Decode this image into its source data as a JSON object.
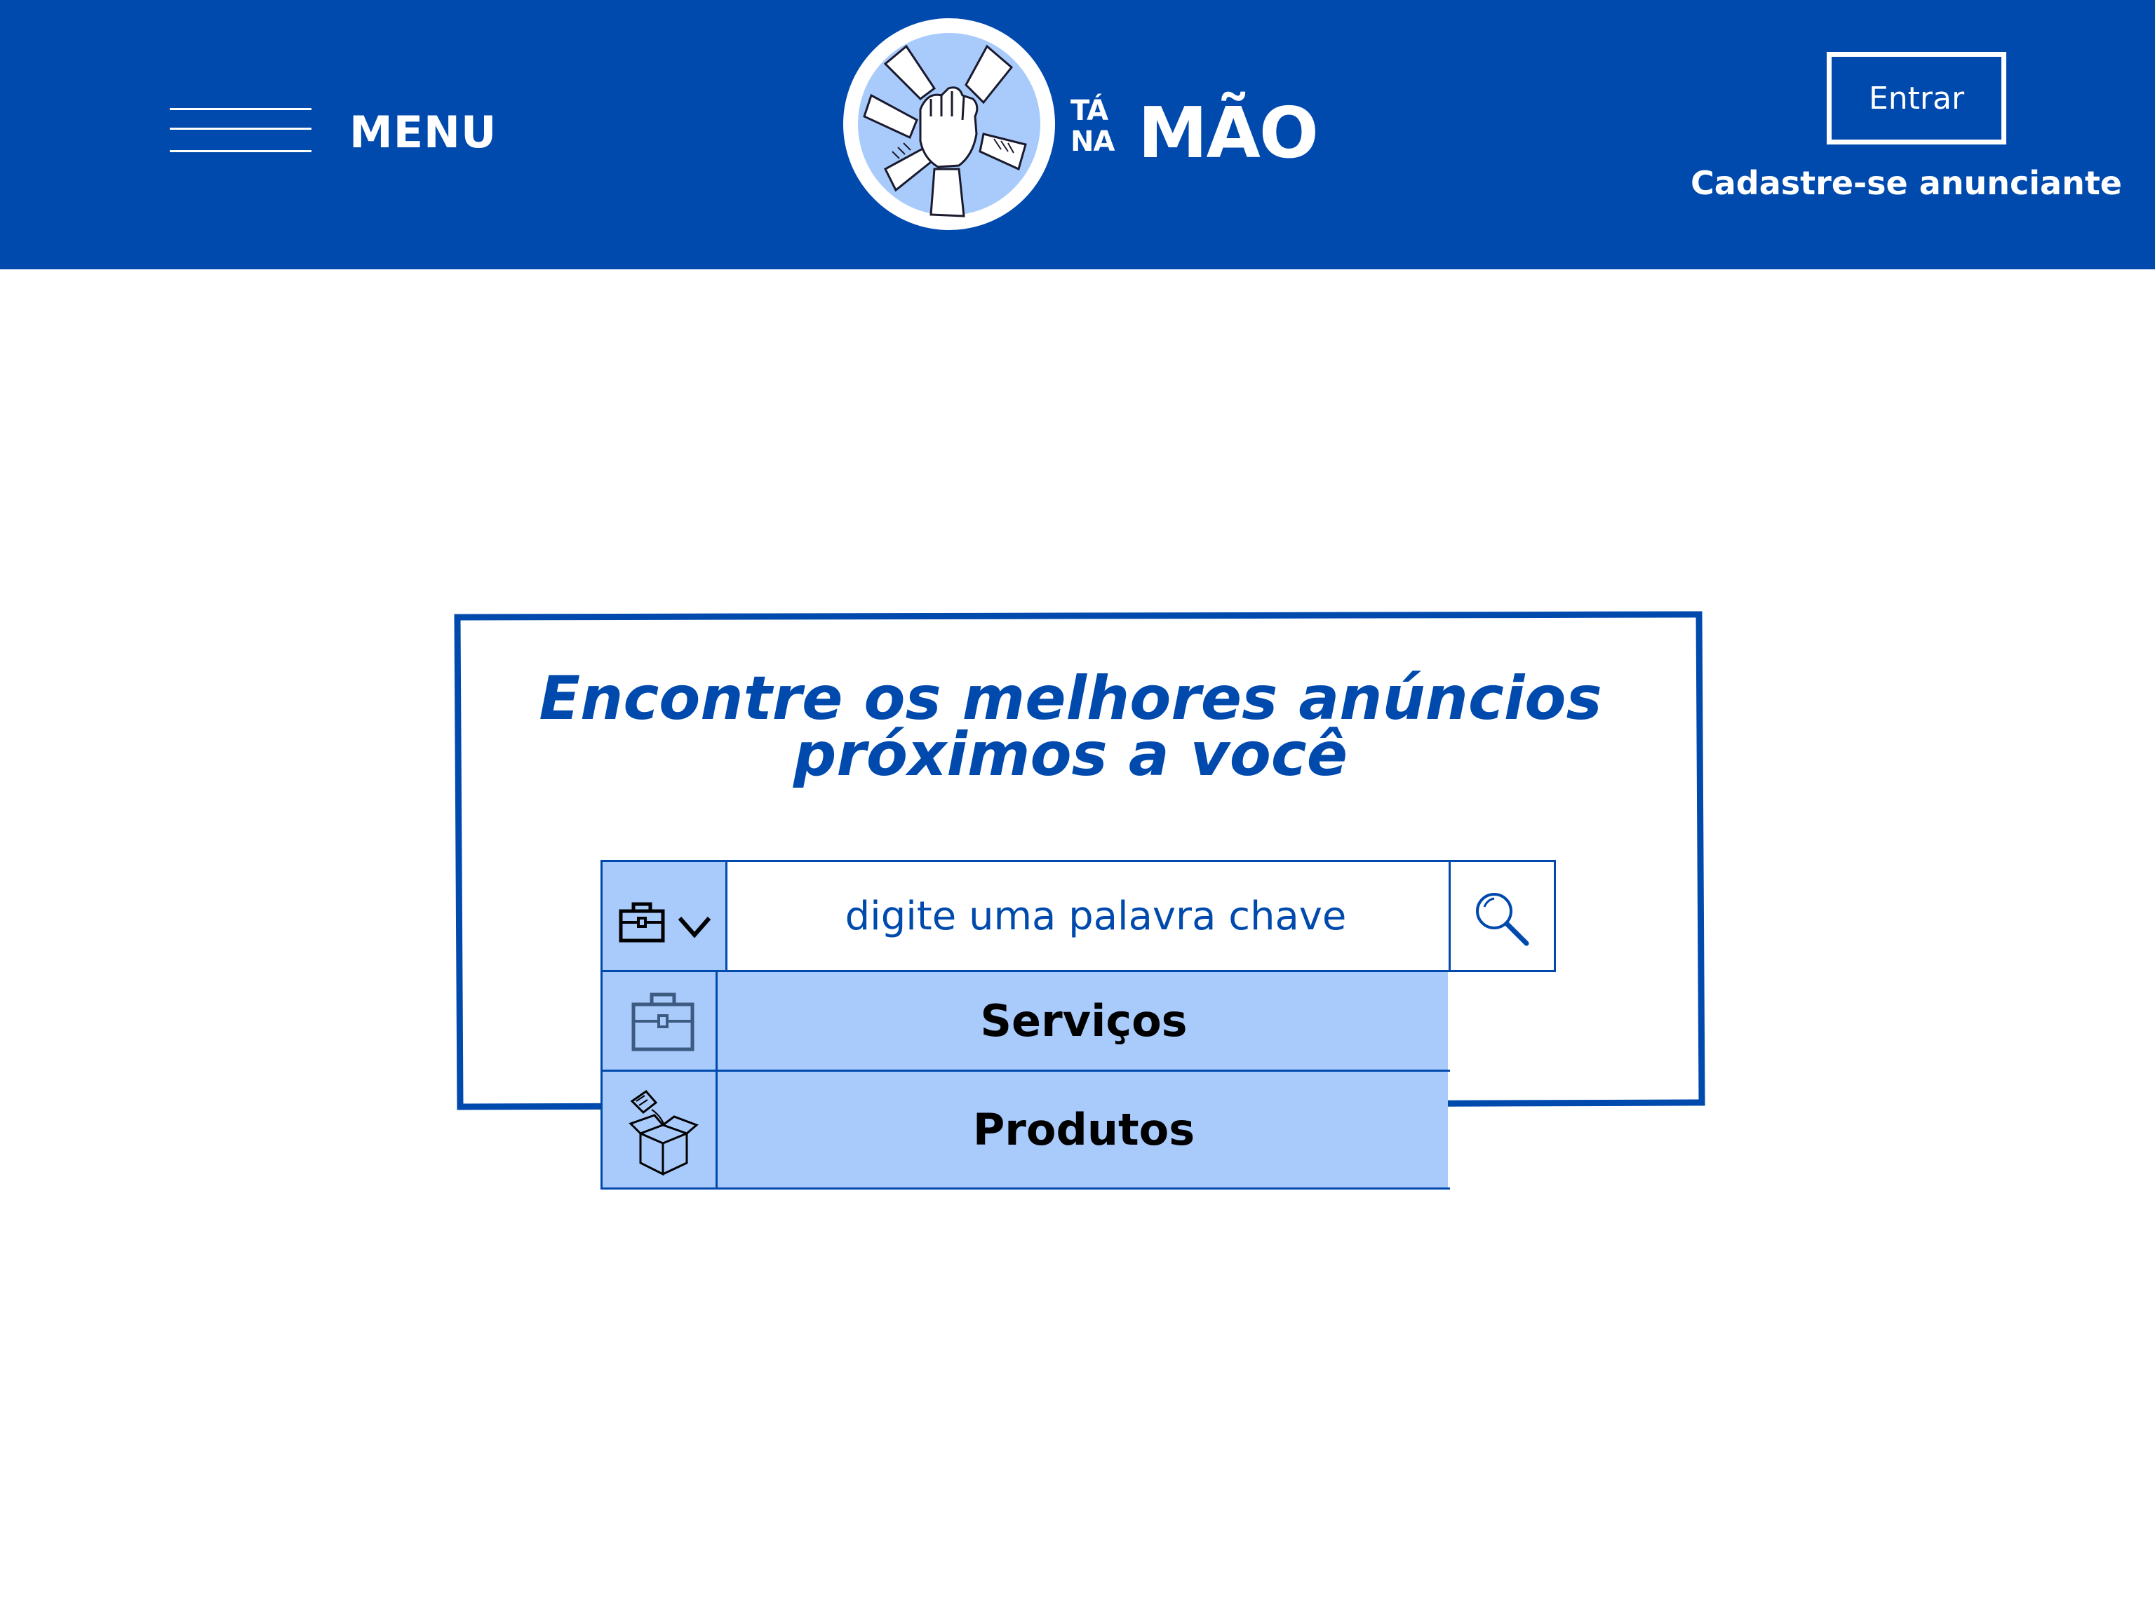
{
  "header": {
    "menu_label": "MENU",
    "logo": {
      "small_line1": "TÁ",
      "small_line2": "NA",
      "big": "MÃO"
    },
    "login_label": "Entrar",
    "register_label": "Cadastre-se anunciante"
  },
  "search": {
    "headline_line1": "Encontre os melhores anúncios",
    "headline_line2": "próximos a você",
    "placeholder": "digite uma palavra chave",
    "category_icon": "briefcase-icon",
    "search_icon": "magnifier-icon",
    "dropdown": [
      {
        "label": "Serviços",
        "icon": "briefcase-icon"
      },
      {
        "label": "Produtos",
        "icon": "open-box-icon"
      }
    ]
  },
  "colors": {
    "brand_blue": "#0049ad",
    "light_blue": "#a9cbfc",
    "white": "#ffffff"
  }
}
